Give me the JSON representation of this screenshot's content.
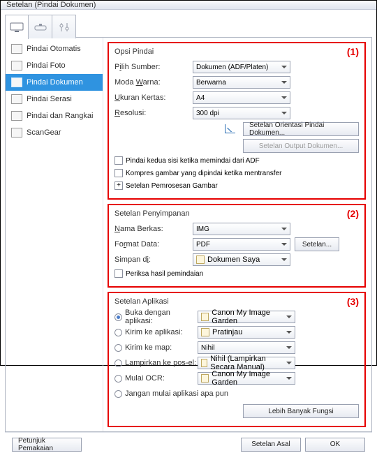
{
  "title": "Setelan (Pindai Dokumen)",
  "sidebar": {
    "items": [
      {
        "label": "Pindai Otomatis"
      },
      {
        "label": "Pindai Foto"
      },
      {
        "label": "Pindai Dokumen"
      },
      {
        "label": "Pindai Serasi"
      },
      {
        "label": "Pindai dan Rangkai"
      },
      {
        "label": "ScanGear"
      }
    ]
  },
  "section_numbers": {
    "g1": "(1)",
    "g2": "(2)",
    "g3": "(3)"
  },
  "g1": {
    "title": "Opsi Pindai",
    "source_label_pre": "P",
    "source_label_u": "i",
    "source_label_post": "lih Sumber:",
    "source_value": "Dokumen (ADF/Platen)",
    "color_label_pre": "Moda ",
    "color_label_u": "W",
    "color_label_post": "arna:",
    "color_value": "Berwarna",
    "size_label_pre": "",
    "size_label_u": "U",
    "size_label_post": "kuran Kertas:",
    "size_value": "A4",
    "res_label_pre": "",
    "res_label_u": "R",
    "res_label_post": "esolusi:",
    "res_value": "300 dpi",
    "orient_btn": "Setelan Orientasi Pindai Dokumen...",
    "output_btn": "Setelan Output Dokumen...",
    "chk1": "Pindai kedua sisi ketika memindai dari ADF",
    "chk2": "Kompres gambar yang dipindai ketika mentransfer",
    "img_proc": "Setelan Pemrosesan Gambar"
  },
  "g2": {
    "title": "Setelan Penyimpanan",
    "name_label_pre": "",
    "name_label_u": "N",
    "name_label_post": "ama Berkas:",
    "name_value": "IMG",
    "fmt_label_pre": "Fo",
    "fmt_label_u": "r",
    "fmt_label_post": "mat Data:",
    "fmt_value": "PDF",
    "settings_btn": "Setelan...",
    "save_label_pre": "Simpan d",
    "save_label_u": "i",
    "save_label_post": ":",
    "save_value": "Dokumen Saya",
    "chk": "Periksa hasil pemindaian"
  },
  "g3": {
    "title": "Setelan Aplikasi",
    "r1": "Buka dengan aplikasi:",
    "r1_value": "Canon My Image Garden",
    "r2": "Kirim ke aplikasi:",
    "r2_value": "Pratinjau",
    "r3": "Kirim ke map:",
    "r3_value": "Nihil",
    "r4": "Lampirkan ke pos-el:",
    "r4_value": "Nihil (Lampirkan Secara Manual)",
    "r5": "Mulai OCR:",
    "r5_value": "Canon My Image Garden",
    "r6": "Jangan mulai aplikasi apa pun",
    "more_btn": "Lebih Banyak Fungsi"
  },
  "footer": {
    "help": "Petunjuk Pemakaian",
    "defaults": "Setelan Asal",
    "ok": "OK"
  }
}
